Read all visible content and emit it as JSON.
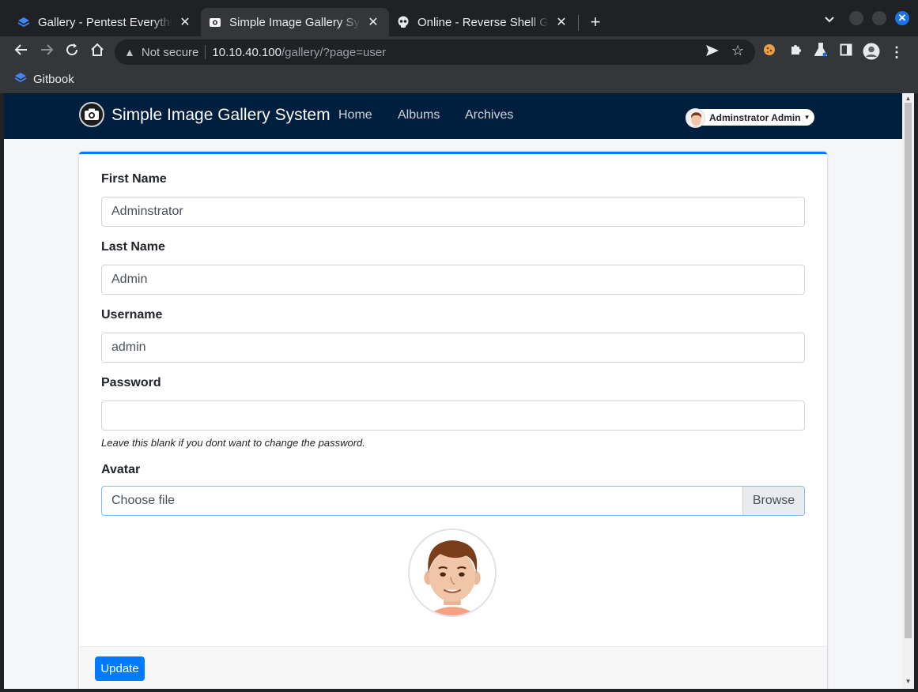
{
  "browser": {
    "tabs": [
      {
        "title": "Gallery - Pentest Everything",
        "active": false
      },
      {
        "title": "Simple Image Gallery System",
        "active": true
      },
      {
        "title": "Online - Reverse Shell Generator",
        "active": false
      }
    ],
    "address": {
      "security": "Not secure",
      "host": "10.10.40.100",
      "path": "/gallery/?page=user"
    },
    "bookmarks": [
      {
        "label": "Gitbook"
      }
    ]
  },
  "navbar": {
    "brand": "Simple Image Gallery System",
    "links": [
      "Home",
      "Albums",
      "Archives"
    ],
    "user": "Adminstrator Admin"
  },
  "form": {
    "first_name": {
      "label": "First Name",
      "value": "Adminstrator"
    },
    "last_name": {
      "label": "Last Name",
      "value": "Admin"
    },
    "username": {
      "label": "Username",
      "value": "admin"
    },
    "password": {
      "label": "Password",
      "value": "",
      "help": "Leave this blank if you dont want to change the password."
    },
    "avatar": {
      "label": "Avatar",
      "file_placeholder": "Choose file",
      "browse": "Browse"
    },
    "submit": "Update"
  },
  "colors": {
    "navbar_bg": "#001f3f",
    "primary": "#007bff",
    "page_bg": "#f4f6f9",
    "chrome_bg": "#202124",
    "chrome_toolbar": "#35363a"
  }
}
